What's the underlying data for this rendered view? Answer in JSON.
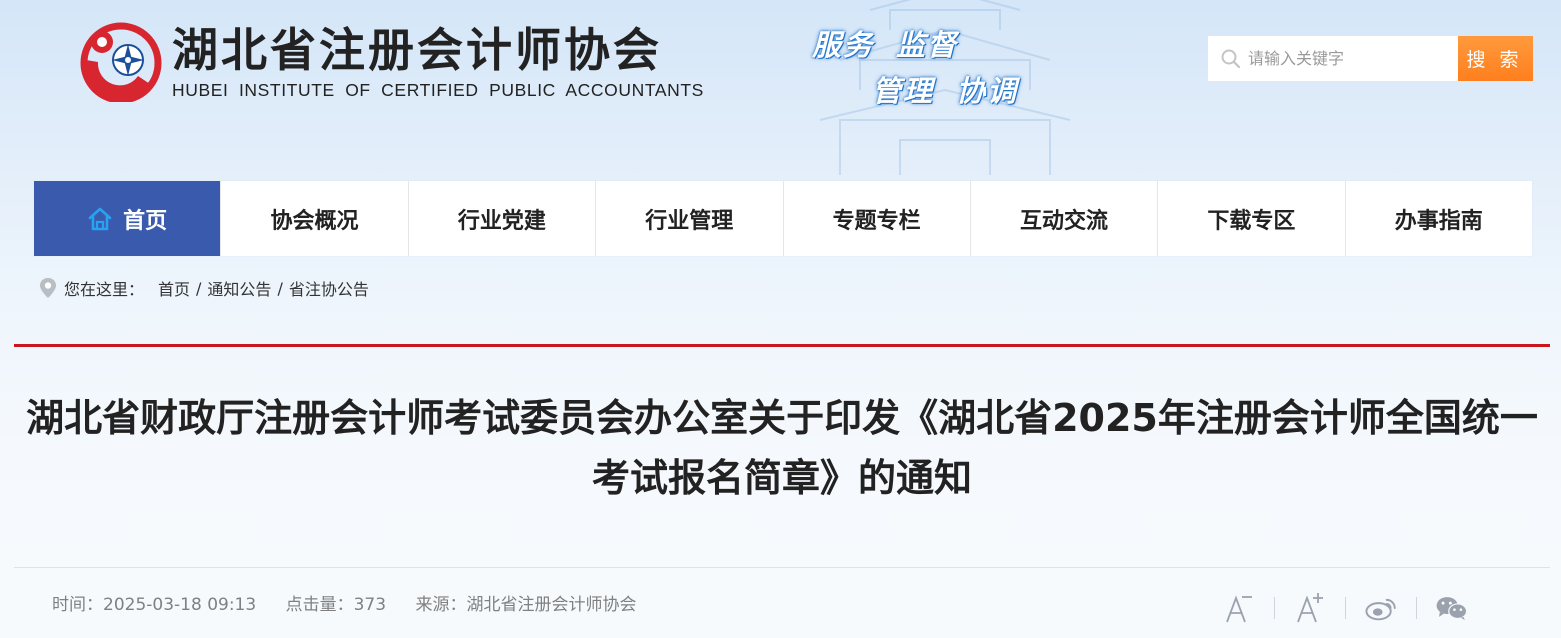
{
  "header": {
    "org_name_cn": "湖北省注册会计师协会",
    "org_name_en": "HUBEI INSTITUTE OF CERTIFIED PUBLIC ACCOUNTANTS",
    "slogan_line1": [
      "服务",
      "监督"
    ],
    "slogan_line2": [
      "管理",
      "协调"
    ],
    "search": {
      "placeholder": "请输入关键字",
      "button_label": "搜 索"
    }
  },
  "nav": {
    "items": [
      {
        "label": "首页",
        "active": true
      },
      {
        "label": "协会概况"
      },
      {
        "label": "行业党建"
      },
      {
        "label": "行业管理"
      },
      {
        "label": "专题专栏"
      },
      {
        "label": "互动交流"
      },
      {
        "label": "下载专区"
      },
      {
        "label": "办事指南"
      }
    ]
  },
  "breadcrumb": {
    "prefix": "您在这里：",
    "items": [
      "首页",
      "通知公告",
      "省注协公告"
    ],
    "separator": "/"
  },
  "article": {
    "title": "湖北省财政厅注册会计师考试委员会办公室关于印发《湖北省2025年注册会计师全国统一考试报名简章》的通知",
    "time_label": "时间：",
    "time": "2025-03-18 09:13",
    "clicks_label": "点击量：",
    "clicks": "373",
    "source_label": "来源：",
    "source": "湖北省注册会计师协会"
  },
  "colors": {
    "nav_active": "#3a5aad",
    "search_button": "#ff8a2a",
    "divider_red": "#c8161d",
    "logo_red": "#d7262f"
  },
  "icons": [
    "home-icon",
    "search-icon",
    "location-pin-icon",
    "font-decrease-icon",
    "font-increase-icon",
    "weibo-icon",
    "wechat-icon"
  ]
}
